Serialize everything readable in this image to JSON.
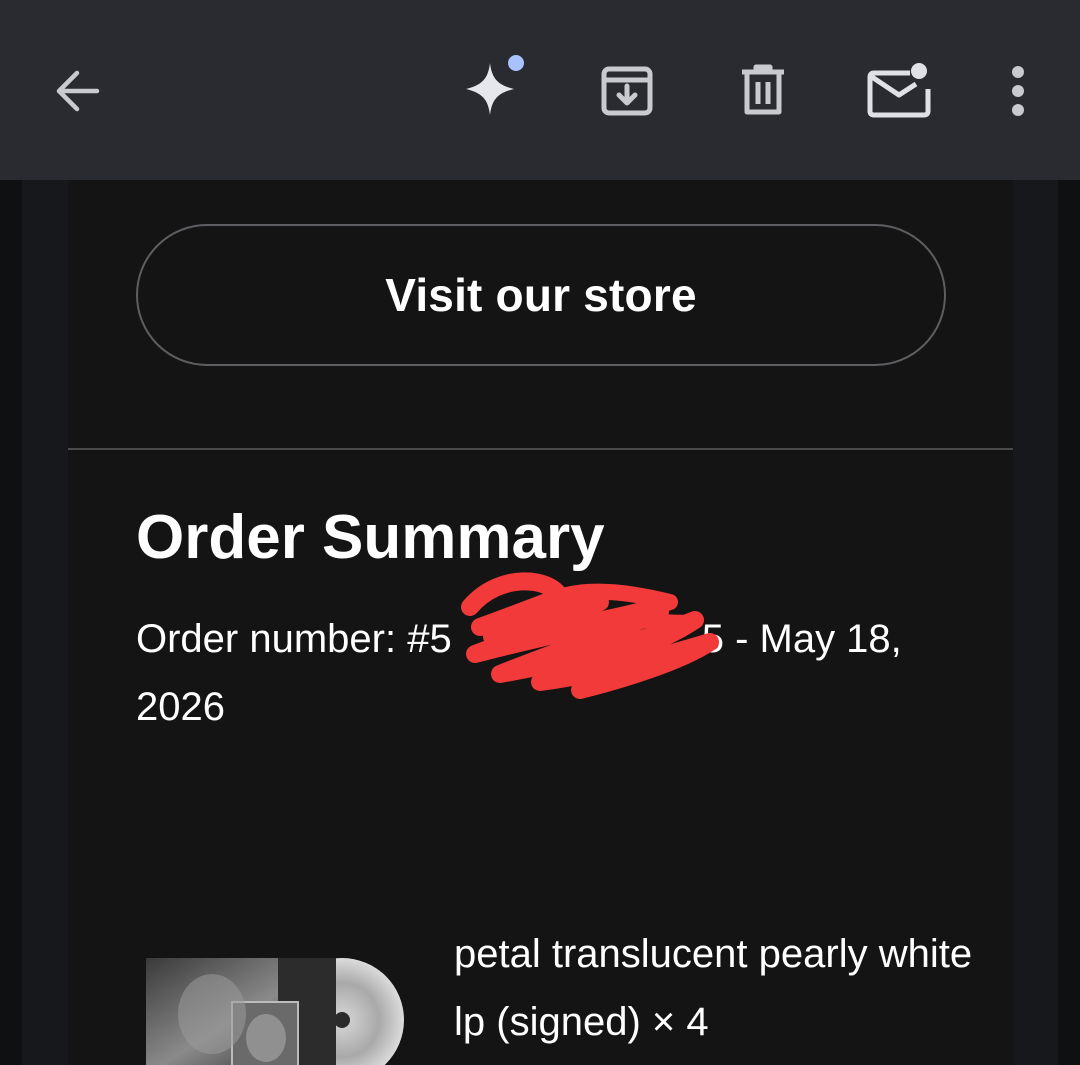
{
  "toolbar": {
    "back_icon": "arrow-left-icon",
    "gemini_icon": "sparkle-icon",
    "archive_icon": "archive-icon",
    "delete_icon": "trash-icon",
    "mark_unread_icon": "mail-unread-icon",
    "more_icon": "more-vert-icon",
    "background_color": "#2a2b30",
    "notification_dot_color": "#a8c1ff"
  },
  "email": {
    "store_button_label": "Visit our store",
    "order_title": "Order Summary",
    "order_number_prefix": "Order number: #5",
    "order_number_suffix": "5 - May 18, 2026",
    "redaction_color": "#f23a3a",
    "item": {
      "name": "petal translucent pearly white lp (signed) × 4"
    }
  }
}
